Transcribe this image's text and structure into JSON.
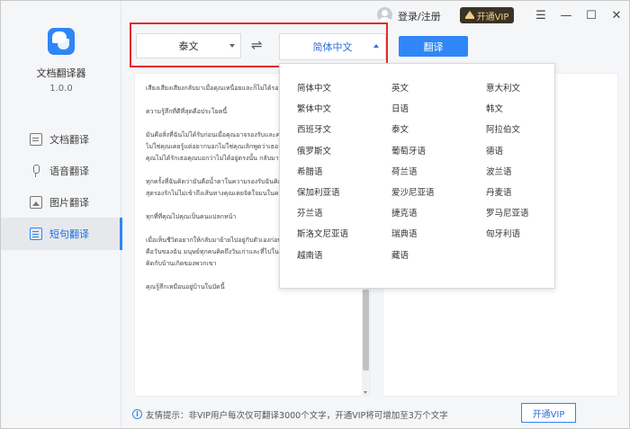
{
  "app": {
    "name": "文档翻译器",
    "version": "1.0.0"
  },
  "sidebar": {
    "items": [
      {
        "label": "文档翻译",
        "icon": "document-icon"
      },
      {
        "label": "语音翻译",
        "icon": "microphone-icon"
      },
      {
        "label": "图片翻译",
        "icon": "image-icon"
      },
      {
        "label": "短句翻译",
        "icon": "short-text-icon",
        "active": true
      }
    ]
  },
  "topbar": {
    "login_label": "登录/注册",
    "vip_label": "开通VIP",
    "minimize": "—",
    "maximize": "☐",
    "close": "✕",
    "menu": "☰"
  },
  "controls": {
    "source_lang": "泰文",
    "swap_symbol": "⇌",
    "target_lang": "简体中文",
    "translate_label": "翻译"
  },
  "source_text": "เสียงเสียงเสียงกลับมาเมื่อคุณเหนื่อยและก็ไม่ได้รอย\n\nความรู้สึกที่ดีที่สุดคือประโยคนี้\n\nมันคือสิ่งที่ฉันไม่ได้รับก่อนเมื่อคุณอาจรองรับและความรัก\nไม่ใช่คุณเคยรู้แต่อยากบอกไม่ใช่คุณเลิกพูดว่าเธอรัก\nคุณไม่ได้รักเธอคุณบอกว่าไม่ได้อยู่ตรงนั้น กลับมาแล้ว\n\nทุกครั้งที่ฉันคิดว่ามันคือน้ำตาในความรองรับฉันคิดว่า\nสุดรองรักไม่ไม่เข้าถึงเส้นทางคุณเคยจิตใจมนในความรัก\n\nทุกที่ที่คุณไปคุณเป็นคนแปลกหน้า\n\nเมื่อเห็นชีวิตอยากให้กลับมาย้ายไปอยู่กับตัวเองก่อนจะปรับ\nคือวันของฉัน มนุษย์ทุกคนคิดถึงวันเก่าและที่ไปในการใจ\nคิดกับบ้านเกิดของพวกเขา\n\nคุณรู้สึกเหมือนอยู่บ้านในบัดนี้",
  "languages": [
    [
      "简体中文",
      "英文",
      "意大利文"
    ],
    [
      "繁体中文",
      "日语",
      "韩文"
    ],
    [
      "西班牙文",
      "泰文",
      "阿拉伯文"
    ],
    [
      "俄罗斯文",
      "葡萄牙语",
      "德语"
    ],
    [
      "希腊语",
      "荷兰语",
      "波兰语"
    ],
    [
      "保加利亚语",
      "爱沙尼亚语",
      "丹麦语"
    ],
    [
      "芬兰语",
      "捷克语",
      "罗马尼亚语"
    ],
    [
      "斯洛文尼亚语",
      "瑞典语",
      "匈牙利语"
    ],
    [
      "越南语",
      "藏语"
    ]
  ],
  "footer": {
    "tip": "友情提示：非VIP用户每次仅可翻译3000个文字，开通VIP将可增加至3万个文字",
    "vip_button": "开通VIP"
  },
  "colors": {
    "accent": "#2f86f6",
    "highlight_frame": "#e22b2b",
    "vip_bg": "#3a3226",
    "vip_text": "#f1cf86"
  }
}
